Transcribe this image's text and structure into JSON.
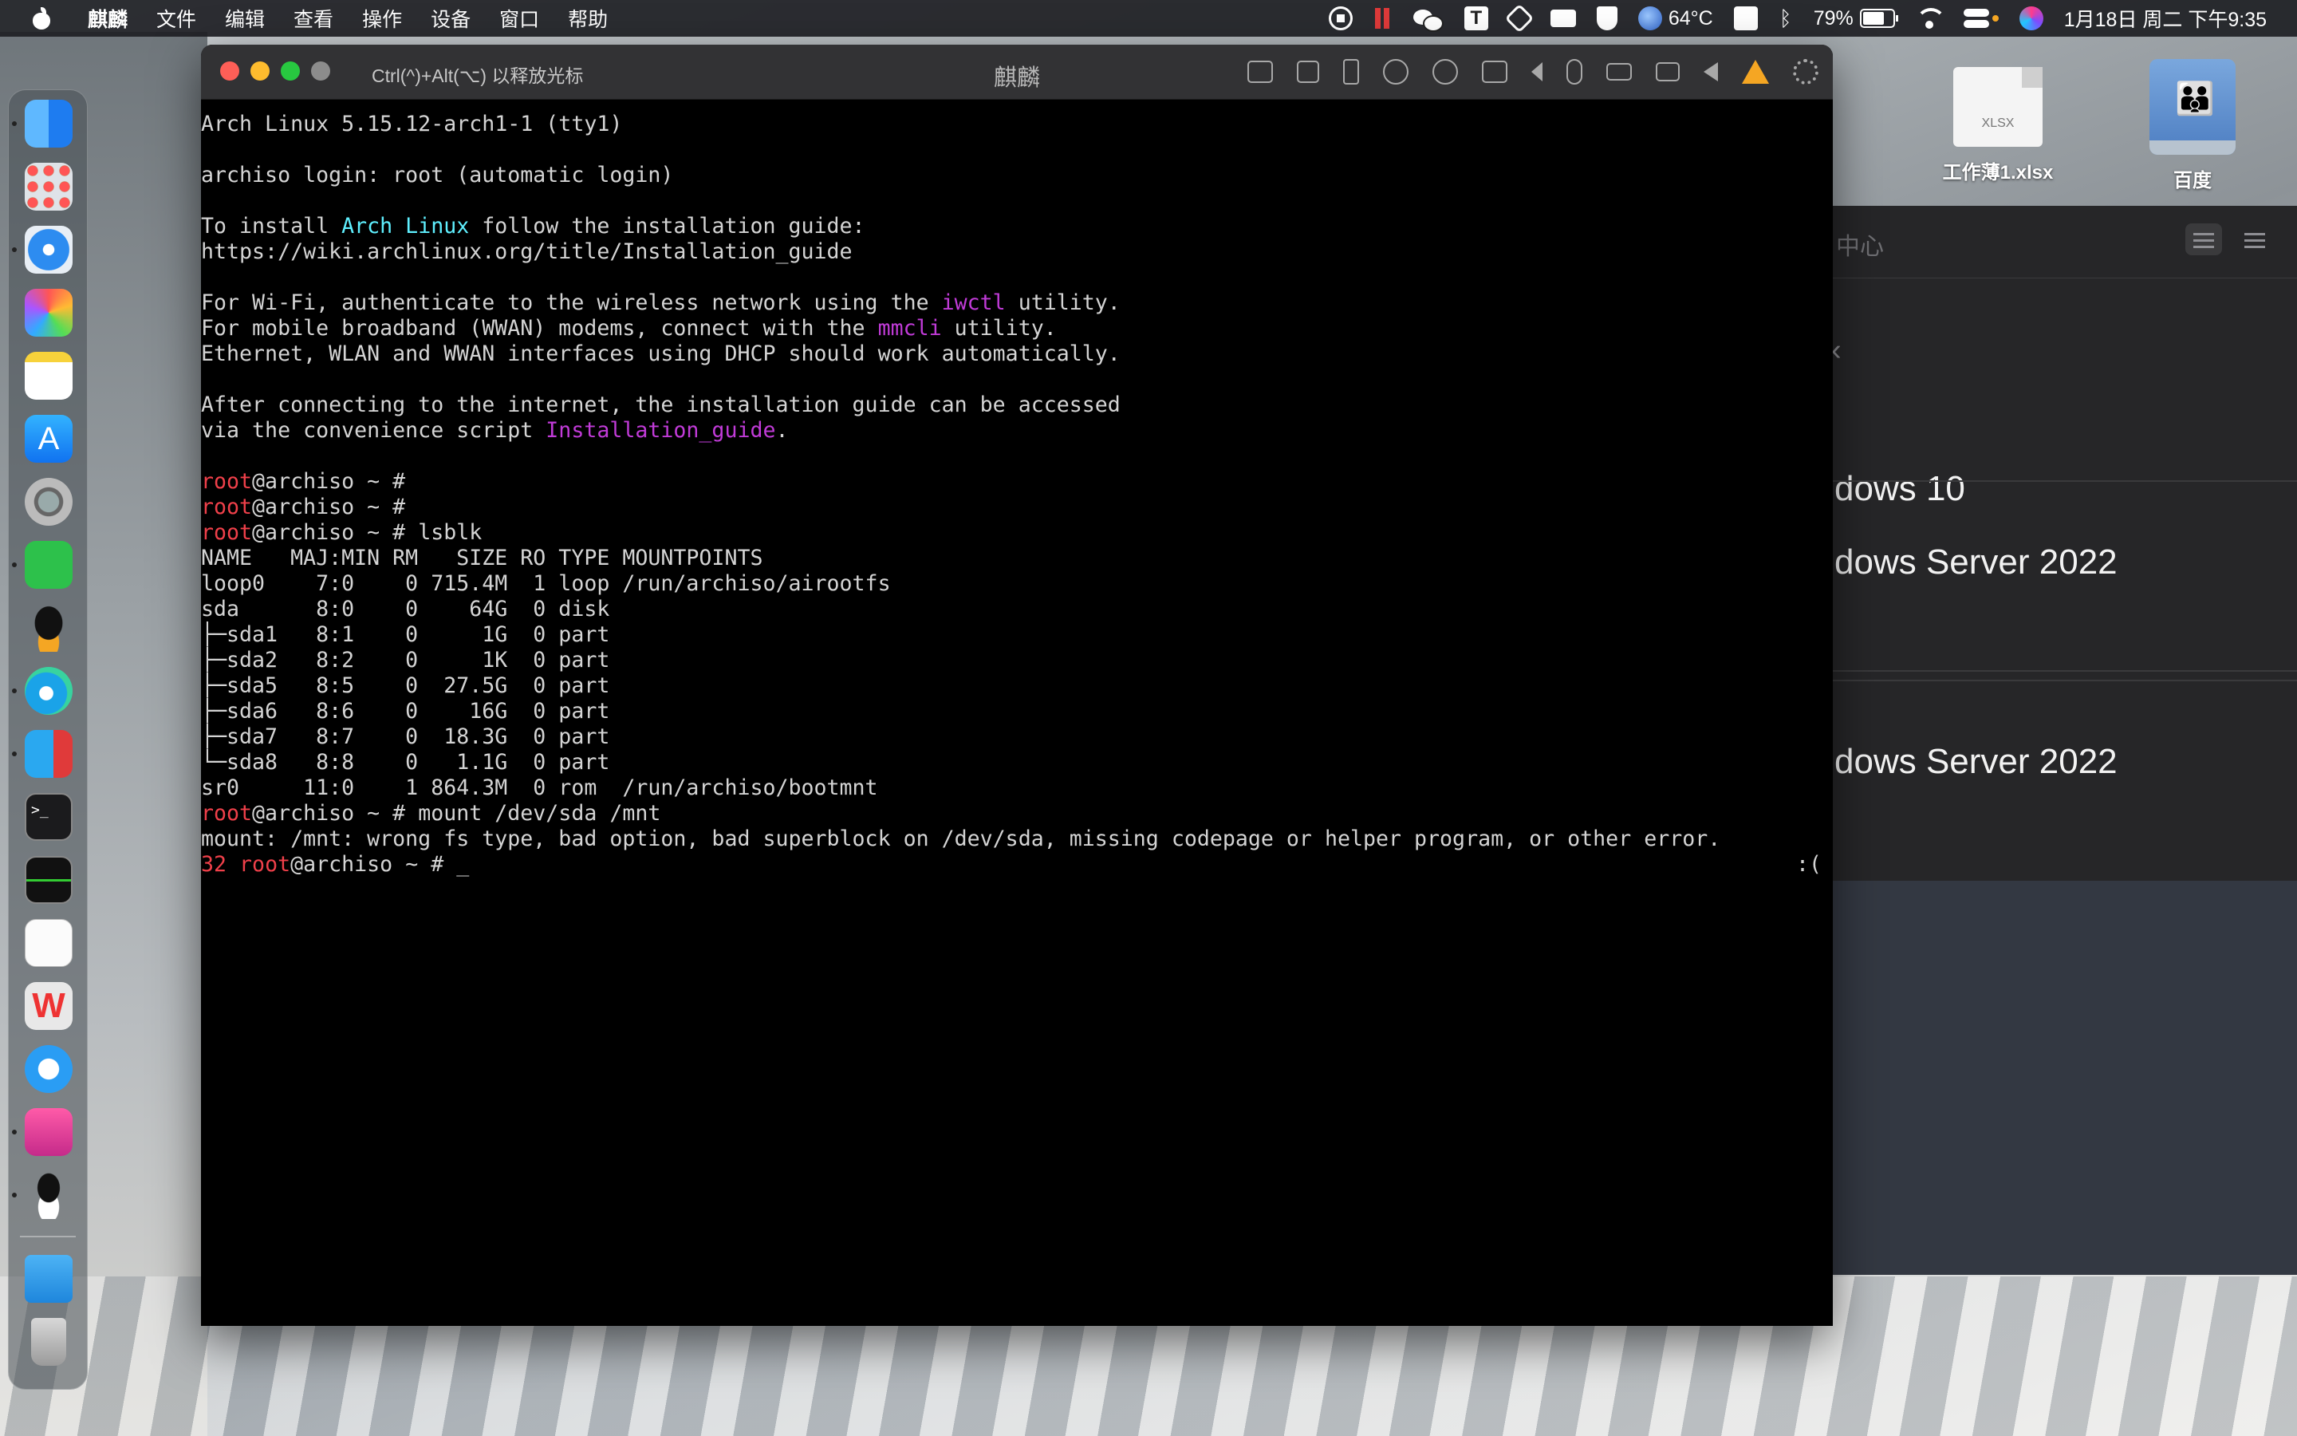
{
  "menubar": {
    "app_name": "麒麟",
    "menus": [
      "文件",
      "编辑",
      "查看",
      "操作",
      "设备",
      "窗口",
      "帮助"
    ],
    "temperature": "64°C",
    "battery": "79%",
    "datetime": "1月18日 周二 下午9:35",
    "status_icons": [
      "screen-record-icon",
      "pause-icon",
      "wechat-icon",
      "text-icon",
      "hexagon-icon",
      "monitor-icon",
      "shield-icon",
      "temperature-icon",
      "pinyin-icon",
      "bluetooth-icon",
      "battery-icon",
      "wifi-icon",
      "control-center-icon",
      "siri-icon"
    ]
  },
  "desktop": {
    "files": [
      {
        "label": "工作薄1.xlsx",
        "ext": "XLSX"
      },
      {
        "label": "百度"
      }
    ]
  },
  "bg_app": {
    "toolbar_title": "中心",
    "back_glyph": "‹",
    "vms": [
      "dows 10",
      "dows Server 2022",
      "dows Server 2022"
    ]
  },
  "vm_window": {
    "hint": "Ctrl(^)+Alt(⌥) 以释放光标",
    "title": "麒麟",
    "toolbar_icons": [
      "keyboard-icon",
      "cpu-icon",
      "usb-icon",
      "disc-icon",
      "network-icon",
      "printer-icon",
      "speaker-icon",
      "microphone-icon",
      "drive-icon",
      "camera-icon",
      "back-icon",
      "warning-icon",
      "settings-icon"
    ]
  },
  "colors": {
    "prompt_user": "#f0404a",
    "highlight_cyan": "#5ff0ff",
    "highlight_magenta": "#c13bd8",
    "terminal_text": "#d4d4d4",
    "terminal_bg": "#000000"
  },
  "terminal": {
    "banner": "Arch Linux 5.15.12-arch1-1 (tty1)",
    "login": "archiso login: root (automatic login)",
    "install_pre": "To install ",
    "install_hl": "Arch Linux",
    "install_post": " follow the installation guide:",
    "install_url": "https://wiki.archlinux.org/title/Installation_guide",
    "wifi_pre": "For Wi-Fi, authenticate to the wireless network using the ",
    "wifi_hl": "iwctl",
    "wifi_post": " utility.",
    "mobile_pre": "For mobile broadband (WWAN) modems, connect with the ",
    "mobile_hl": "mmcli",
    "mobile_post": " utility.",
    "ethernet": "Ethernet, WLAN and WWAN interfaces using DHCP should work automatically.",
    "after1": "After connecting to the internet, the installation guide can be accessed",
    "after2_pre": "via the convenience script ",
    "after2_hl": "Installation_guide",
    "after2_post": ".",
    "prompt_user": "root",
    "prompt_host": "@archiso ~ #",
    "cmd_lsblk": " lsblk",
    "lsblk_header": "NAME   MAJ:MIN RM   SIZE RO TYPE MOUNTPOINTS",
    "lsblk_rows": [
      "loop0    7:0    0 715.4M  1 loop /run/archiso/airootfs",
      "sda      8:0    0    64G  0 disk",
      "├─sda1   8:1    0     1G  0 part",
      "├─sda2   8:2    0     1K  0 part",
      "├─sda5   8:5    0  27.5G  0 part",
      "├─sda6   8:6    0    16G  0 part",
      "├─sda7   8:7    0  18.3G  0 part",
      "└─sda8   8:8    0   1.1G  0 part",
      "sr0     11:0    1 864.3M  0 rom  /run/archiso/bootmnt"
    ],
    "cmd_mount": " mount /dev/sda /mnt",
    "error": "mount: /mnt: wrong fs type, bad option, bad superblock on /dev/sda, missing codepage or helper program, or other error.",
    "exit_code": "32",
    "cursor": "_",
    "sad_face": ":("
  }
}
